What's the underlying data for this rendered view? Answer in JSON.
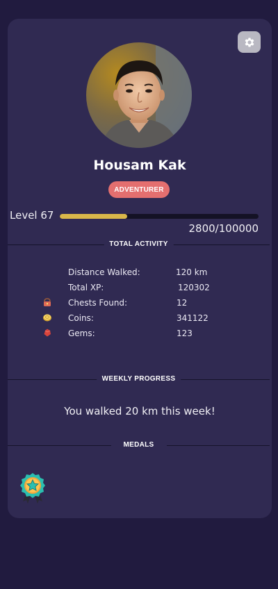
{
  "profile": {
    "name": "Housam Kak",
    "badge": "ADVENTURER"
  },
  "level": {
    "label": "Level 67",
    "xp_text": "2800/100000",
    "progress_fill": 0.34
  },
  "total_activity": {
    "heading": "TOTAL ACTIVITY",
    "rows": [
      {
        "label": "Distance Walked:",
        "value": "120 km",
        "icon": "none"
      },
      {
        "label": "Total XP:",
        "value": "120302",
        "icon": "none"
      },
      {
        "label": "Chests Found:",
        "value": "12",
        "icon": "chest-icon"
      },
      {
        "label": "Coins:",
        "value": "341122",
        "icon": "coin-icon"
      },
      {
        "label": "Gems:",
        "value": "123",
        "icon": "gem-icon"
      }
    ]
  },
  "weekly_progress": {
    "heading": "WEEKLY PROGRESS",
    "message": "You walked 20 km this week!"
  },
  "medals": {
    "heading": "MEDALS",
    "items": [
      {
        "icon": "star-medal-icon"
      }
    ]
  },
  "colors": {
    "background": "#211b3f",
    "card": "#302a52",
    "badge": "#e46f6f",
    "xp_fill": "#d9b74a",
    "xp_track": "#141225",
    "settings_button": "#b9b8c2"
  }
}
